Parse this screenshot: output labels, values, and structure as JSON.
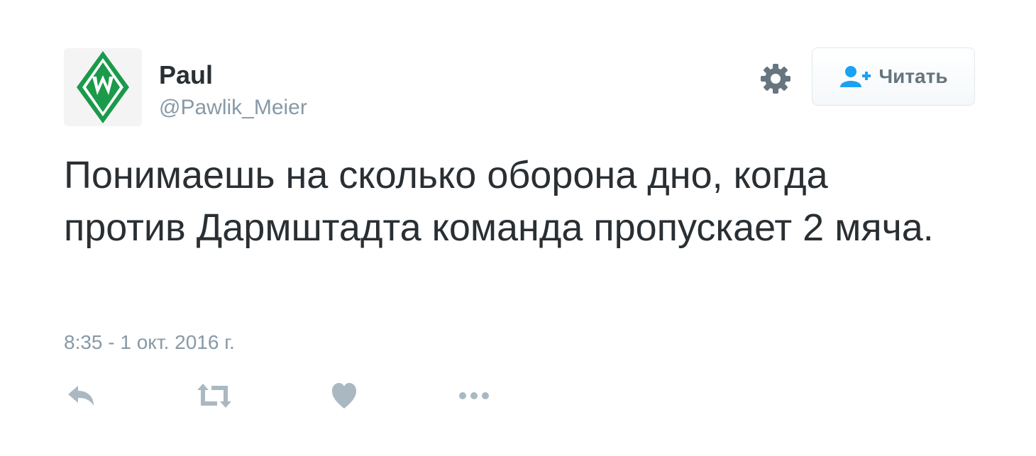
{
  "tweet": {
    "author": {
      "name": "Paul",
      "handle": "@Pawlik_Meier",
      "avatar_icon": "werder-bremen-logo"
    },
    "settings_icon": "gear-icon",
    "follow_button": {
      "label": "Читать",
      "icon": "add-user-icon"
    },
    "text": "Понимаешь на сколько оборона дно, когда против Дармштадта команда пропускает 2 мяча.",
    "timestamp": "8:35 - 1 окт. 2016 г.",
    "actions": [
      {
        "name": "reply",
        "icon": "reply-icon"
      },
      {
        "name": "retweet",
        "icon": "retweet-icon"
      },
      {
        "name": "like",
        "icon": "heart-icon"
      },
      {
        "name": "more",
        "icon": "more-icon"
      }
    ],
    "colors": {
      "text": "#292f33",
      "muted": "#8899a6",
      "icon_gray": "#aab8c2",
      "follow_blue": "#1da1f2",
      "logo_green": "#1a9a4a"
    }
  }
}
